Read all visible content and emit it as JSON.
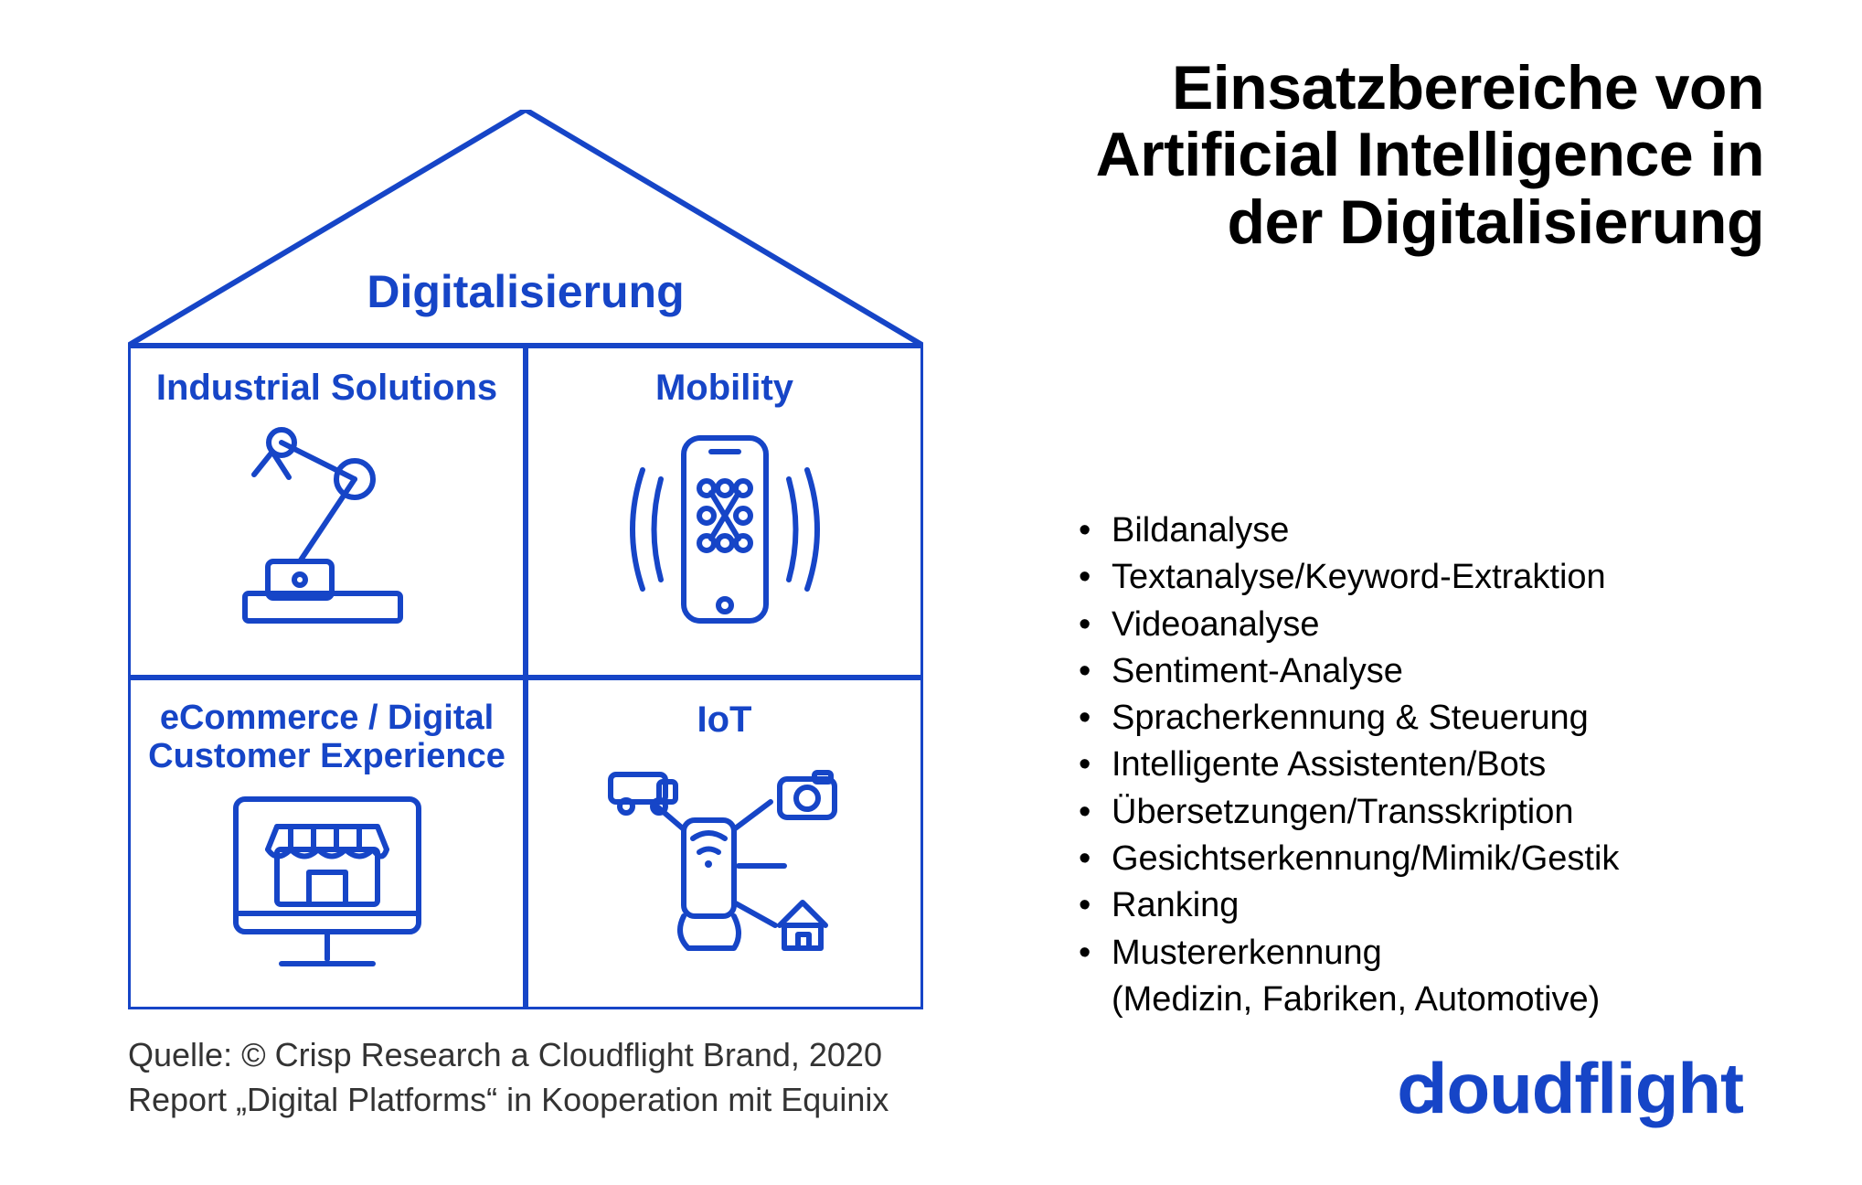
{
  "title_lines": [
    "Einsatzbereiche von",
    "Artificial Intelligence in",
    "der Digitalisierung"
  ],
  "house": {
    "roof_title": "Digitalisierung",
    "cells": [
      {
        "title": "Industrial Solutions",
        "icon": "robot-arm-icon"
      },
      {
        "title": "Mobility",
        "icon": "phone-signal-icon"
      },
      {
        "title": "eCommerce / Digital\nCustomer Experience",
        "icon": "shop-monitor-icon"
      },
      {
        "title": "IoT",
        "icon": "iot-devices-icon"
      }
    ]
  },
  "bullets": [
    "Bildanalyse",
    "Textanalyse/Keyword-Extraktion",
    "Videoanalyse",
    "Sentiment-Analyse",
    "Spracherkennung & Steuerung",
    "Intelligente Assistenten/Bots",
    "Übersetzungen/Transskription",
    "Gesichtserkennung/Mimik/Gestik",
    "Ranking",
    "Mustererkennung"
  ],
  "bullet_subline": "(Medizin, Fabriken, Automotive)",
  "source_lines": [
    "Quelle: © Crisp Research a Cloudflight Brand, 2020",
    "Report „Digital Platforms“ in Kooperation mit Equinix"
  ],
  "brand": "cloudflight",
  "colors": {
    "primary": "#1645c7",
    "text": "#000000"
  }
}
